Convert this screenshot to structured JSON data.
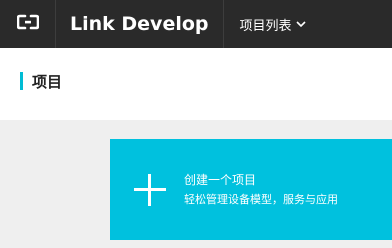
{
  "topbar": {
    "logo_icon": "link-logo-icon",
    "brand": "Link Develop",
    "project_menu_label": "项目列表",
    "project_menu_icon": "chevron-down-icon"
  },
  "page": {
    "title": "项目"
  },
  "create_card": {
    "icon": "plus-icon",
    "title": "创建一个项目",
    "description": "轻松管理设备模型，服务与应用"
  },
  "colors": {
    "topbar_bg": "#2a2a2a",
    "accent": "#00bcd4",
    "card_bg": "#00c1de",
    "page_bg": "#efefef"
  }
}
